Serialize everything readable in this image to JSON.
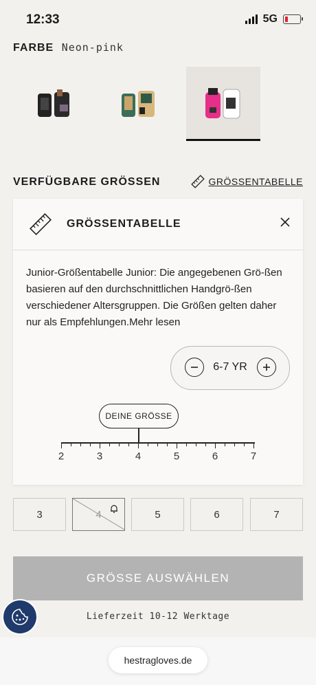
{
  "status_bar": {
    "time": "12:33",
    "network": "5G"
  },
  "color": {
    "label": "FARBE",
    "value": "Neon-pink"
  },
  "swatches": [
    {
      "name": "black"
    },
    {
      "name": "green"
    },
    {
      "name": "neon-pink",
      "selected": true
    }
  ],
  "sizes_section": {
    "title": "VERFÜGBARE GRÖSSEN",
    "chart_link": "GRÖSSENTABELLE"
  },
  "size_panel": {
    "title": "GRÖSSENTABELLE",
    "description": "Junior-Größentabelle Junior: Die angegebenen Grö-ßen basieren auf den durchschnittlichen Handgrö-ßen verschiedener Altersgruppen. Die Größen gelten daher nur als Empfehlungen.Mehr lesen",
    "stepper_value": "6-7 YR",
    "scale_label": "DEINE GRÖSSE",
    "scale_ticks": [
      "2",
      "3",
      "4",
      "5",
      "6",
      "7"
    ],
    "selected_scale_value": "4"
  },
  "size_options": [
    {
      "label": "3",
      "available": true
    },
    {
      "label": "4",
      "available": false
    },
    {
      "label": "5",
      "available": true
    },
    {
      "label": "6",
      "available": true
    },
    {
      "label": "7",
      "available": true
    }
  ],
  "cta": {
    "label": "GRÖSSE AUSWÄHLEN"
  },
  "delivery": {
    "text": "Lieferzeit 10-12 Werktage"
  },
  "browser": {
    "url": "hestragloves.de"
  }
}
